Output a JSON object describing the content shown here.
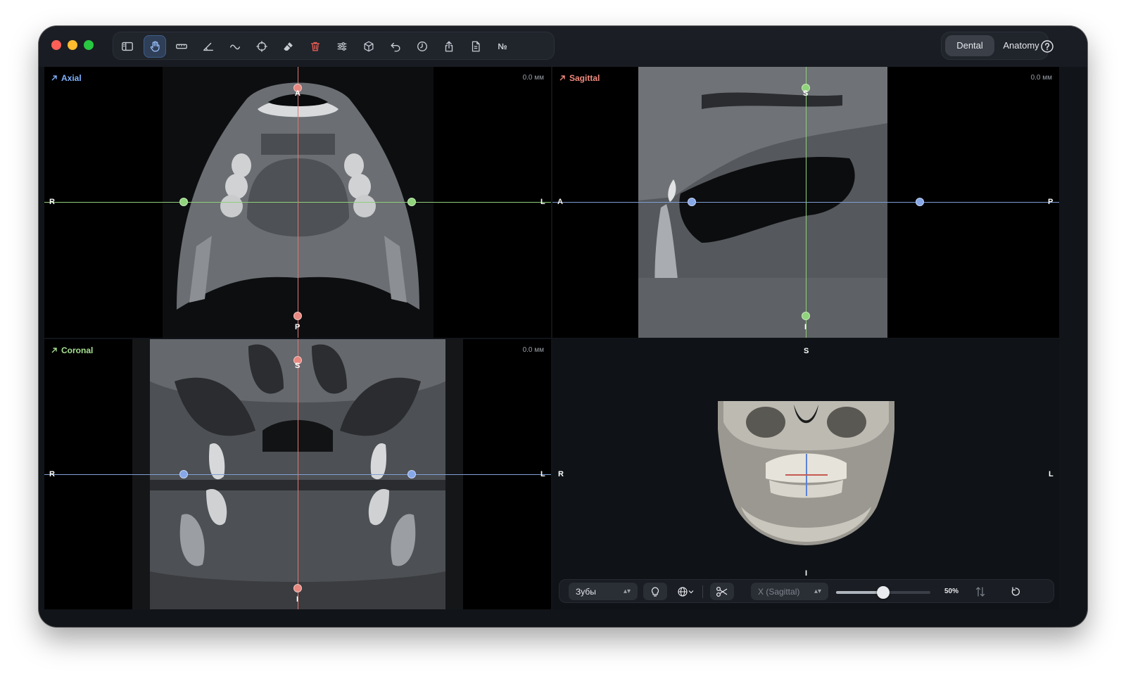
{
  "window": {
    "toolbar_tools": [
      {
        "name": "sidebar-toggle-icon"
      },
      {
        "name": "hand-pointer-icon",
        "active": true
      },
      {
        "name": "ruler-icon"
      },
      {
        "name": "angle-icon"
      },
      {
        "name": "curve-icon"
      },
      {
        "name": "crosshair-icon"
      },
      {
        "name": "eraser-icon"
      },
      {
        "name": "trash-icon"
      },
      {
        "name": "sliders-icon"
      },
      {
        "name": "cube-icon"
      },
      {
        "name": "undo-icon"
      },
      {
        "name": "history-icon"
      },
      {
        "name": "share-icon"
      },
      {
        "name": "document-icon"
      },
      {
        "name": "numero-icon",
        "text": "№"
      }
    ],
    "mode_options": [
      "Dental",
      "Anatomy"
    ],
    "selected_mode": "Dental"
  },
  "panes": {
    "axial": {
      "title": "Axial",
      "title_color": "#7fb3ff",
      "measure": "0.0 мм",
      "labels": {
        "top": "A",
        "bottom": "P",
        "left": "R",
        "right": "L"
      },
      "h_line_color": "#8fcf7a",
      "v_line_color": "#e07a73"
    },
    "sagittal": {
      "title": "Sagittal",
      "title_color": "#f08a7e",
      "measure": "0.0 мм",
      "labels": {
        "top": "S",
        "bottom": "I",
        "left": "A",
        "right": "P"
      },
      "h_line_color": "#7f9ed6",
      "v_line_color": "#8fcf7a"
    },
    "coronal": {
      "title": "Coronal",
      "title_color": "#a5e08f",
      "measure": "0.0 мм",
      "labels": {
        "top": "S",
        "bottom": "I",
        "left": "R",
        "right": "L"
      },
      "h_line_color": "#7f9ed6",
      "v_line_color": "#e07a73"
    },
    "volume3d": {
      "labels": {
        "top": "S",
        "bottom": "I",
        "left": "R",
        "right": "L"
      }
    }
  },
  "bottom_bar": {
    "preset_select": "Зубы",
    "axis_select": "X (Sagittal)",
    "zoom_value": 0.5,
    "zoom_label": "50%",
    "icons": [
      "lightbulb-icon",
      "globe-icon",
      "scissors-icon",
      "flip-icon",
      "reset-icon"
    ]
  }
}
